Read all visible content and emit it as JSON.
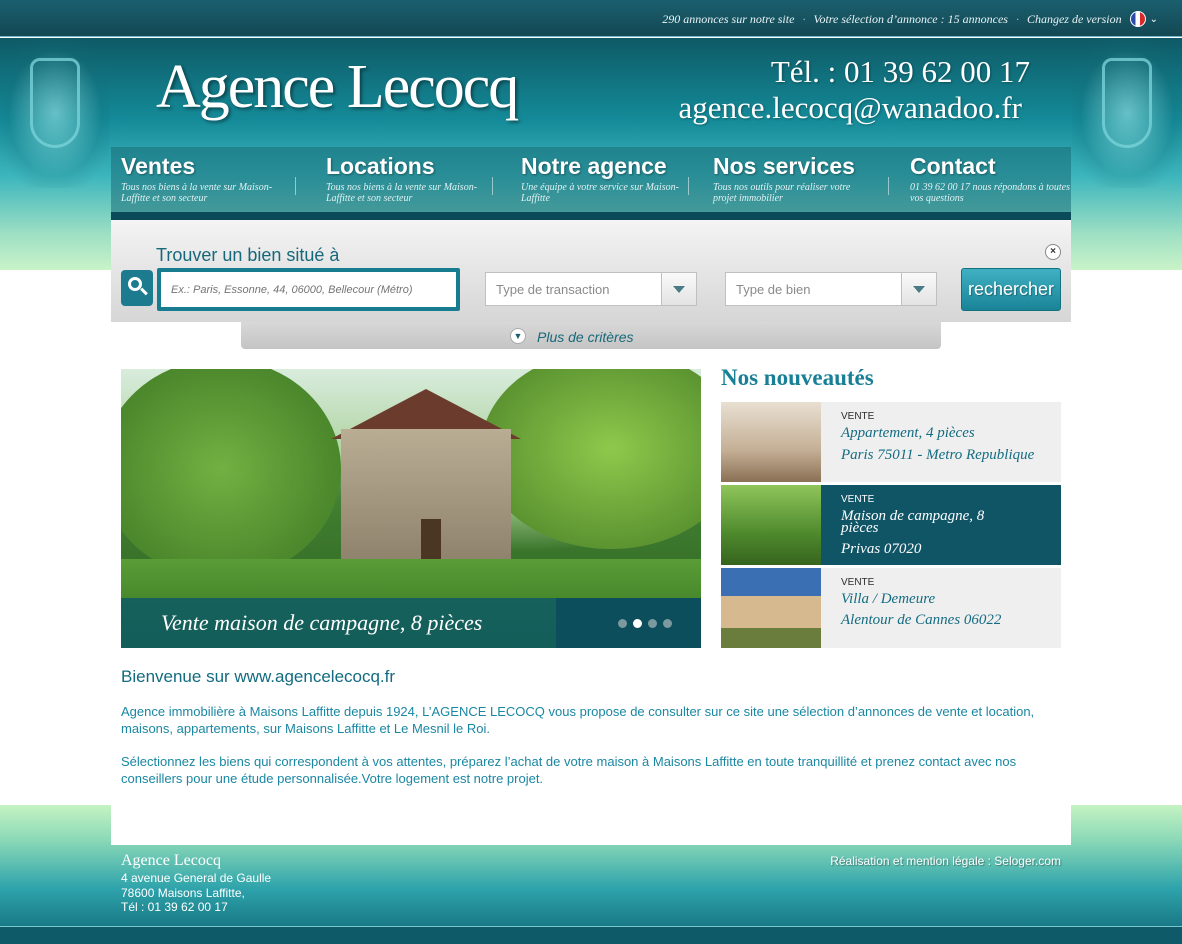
{
  "topbar": {
    "ads_count": "290 annonces sur notre site",
    "selection": "Votre sélection d’annonce : 15 annonces",
    "version": "Changez de version",
    "separator": "·"
  },
  "header": {
    "logo": "Agence Lecocq",
    "phone": "Tél. : 01 39 62 00 17",
    "email": "agence.lecocq@wanadoo.fr"
  },
  "nav": [
    {
      "title": "Ventes",
      "desc": "Tous nos biens à la vente sur Maison-Laffitte et son secteur"
    },
    {
      "title": "Locations",
      "desc": "Tous nos biens à la vente sur Maison-Laffitte et son secteur"
    },
    {
      "title": "Notre agence",
      "desc": "Une équipe à votre service sur Maison-Laffitte"
    },
    {
      "title": "Nos services",
      "desc": "Tous nos outils pour réaliser votre projet immobilier"
    },
    {
      "title": "Contact",
      "desc": "01 39 62 00 17  nous répondons à toutes vos questions"
    }
  ],
  "search": {
    "title": "Trouver un bien situé à",
    "placeholder": "Ex.: Paris, Essonne, 44, 06000, Bellecour (Métro)",
    "transaction": "Type de transaction",
    "property": "Type de bien",
    "button": "rechercher",
    "more": "Plus de critères",
    "close": "×"
  },
  "slideshow": {
    "caption": "Vente maison de campagne, 8 pièces",
    "slide_count": 4,
    "active_slide": 2
  },
  "news": {
    "title": "Nos nouveautés",
    "items": [
      {
        "category": "VENTE",
        "name": "Appartement, 4 pièces",
        "place": "Paris 75011 - Metro Republique"
      },
      {
        "category": "VENTE",
        "name": "Maison de campagne, 8 pièces",
        "place": "Privas 07020"
      },
      {
        "category": "VENTE",
        "name": "Villa / Demeure",
        "place": "Alentour de Cannes 06022"
      }
    ]
  },
  "content": {
    "welcome": "Bienvenue sur www.agencelecocq.fr",
    "p1": "Agence immobilière à Maisons Laffitte depuis 1924, L’AGENCE LECOCQ vous propose de consulter sur ce site une sélection d’annonces de vente et location, maisons, appartements, sur Maisons Laffitte et Le Mesnil le Roi.",
    "p2": "Sélectionnez les biens qui correspondent à vos attentes, préparez l’achat de votre maison à Maisons Laffitte en toute tranquillité et prenez contact avec nos conseillers pour une étude personnalisée.Votre logement est notre projet."
  },
  "footer": {
    "name": "Agence Lecocq",
    "address1": "4 avenue General de Gaulle",
    "address2": "78600 Maisons Laffitte,",
    "phone": "Tél : 01 39 62 00 17",
    "legal": "Réalisation et mention légale : Seloger.com"
  },
  "colors": {
    "brand_teal": "#177f96",
    "dark_teal": "#0f5566",
    "text_teal": "#1a87a3"
  }
}
